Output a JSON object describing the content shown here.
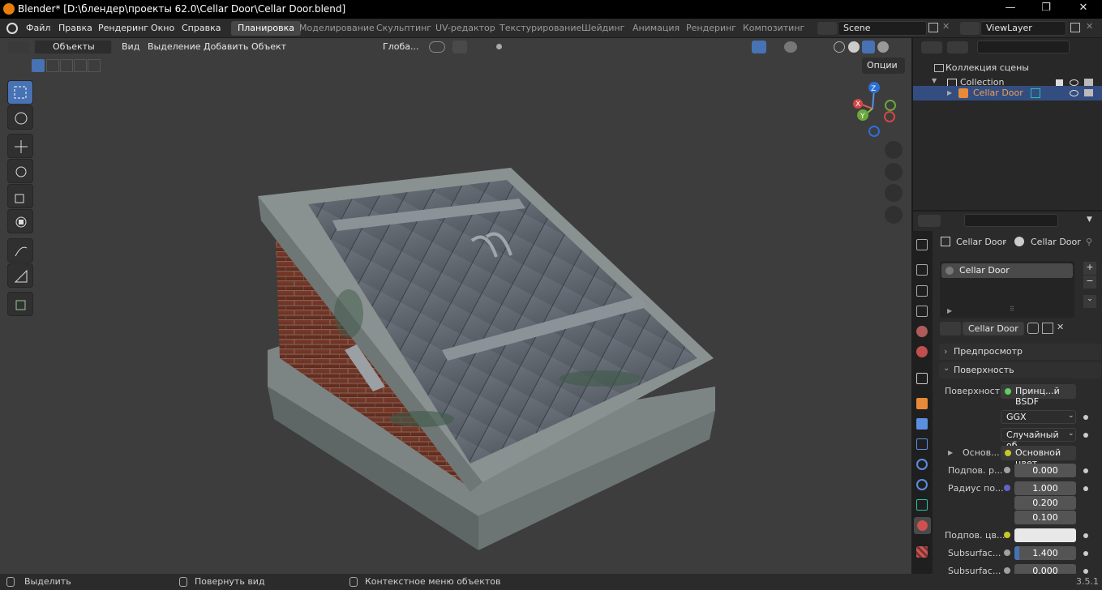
{
  "title": "Blender* [D:\\блендер\\проекты 62.0\\Cellar Door\\Cellar Door.blend]",
  "menu": [
    "Файл",
    "Правка",
    "Рендеринг",
    "Окно",
    "Справка"
  ],
  "workspaces": [
    "Планировка",
    "Моделирование",
    "Скульптинг",
    "UV-редактор",
    "Текстурирование",
    "Шейдинг",
    "Анимация",
    "Рендеринг",
    "Композитинг"
  ],
  "active_workspace": "Планировка",
  "scene": "Scene",
  "view_layer": "ViewLayer",
  "viewport": {
    "mode": "Объекты",
    "menus": [
      "Вид",
      "Выделение",
      "Добавить",
      "Объект"
    ],
    "transform_orientation": "Глоба...",
    "options_label": "Опции",
    "gizmo": {
      "x": "X",
      "y": "Y",
      "z": "Z"
    }
  },
  "outliner": {
    "scene_collection": "Коллекция сцены",
    "collection": "Collection",
    "object": "Cellar Door"
  },
  "properties": {
    "breadcrumb_object": "Cellar Door",
    "breadcrumb_material": "Cellar Door",
    "material_slot": "Cellar Door",
    "material_name": "Cellar Door",
    "sections": {
      "preview": "Предпросмотр",
      "surface": "Поверхность"
    },
    "surface_label": "Поверхность",
    "surface_value": "Принц...й BSDF",
    "distribution": "GGX",
    "subsurface_method": "Случайный об...",
    "base_label": "Основ...",
    "base_value": "Основной цвет",
    "subsurface_label": "Подпов. р...",
    "subsurface_value": "0.000",
    "radius_label": "Радиус по...",
    "radius_values": [
      "1.000",
      "0.200",
      "0.100"
    ],
    "subsurface_color_label": "Подпов. цв...",
    "ior_label": "Subsurfac...",
    "ior_value": "1.400",
    "aniso_label": "Subsurfac...",
    "aniso_value": "0.000"
  },
  "status": {
    "select": "Выделить",
    "rotate": "Повернуть вид",
    "context": "Контекстное меню объектов",
    "version": "3.5.1"
  },
  "colors": {
    "accent": "#4772b3",
    "object_name": "#f0a050",
    "viewport_bg": "#3d3d3d"
  }
}
